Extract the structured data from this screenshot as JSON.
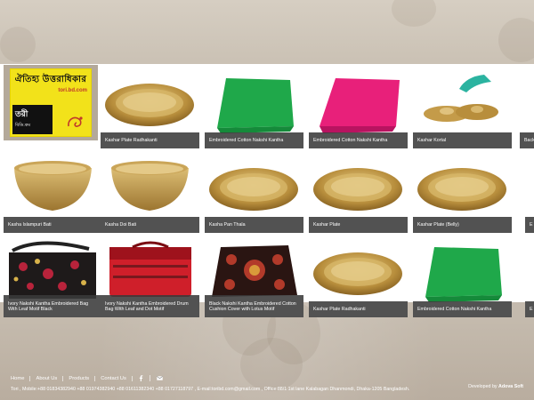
{
  "logo": {
    "title": "ঐতিহ্য উত্তরাধিকার",
    "site": "tori.bd.com",
    "brand": "তরী",
    "sub": "বিডি.কম"
  },
  "products": [
    {
      "name": "Kashar Plate Radhakanti",
      "art": "plate"
    },
    {
      "name": "Embroidered Cotton Nakshi Kantha",
      "art": "green"
    },
    {
      "name": "Embroidered Cotton Nakshi Kantha",
      "art": "pink"
    },
    {
      "name": "Kashar Kortal",
      "art": "cymbal"
    },
    {
      "name": "Back",
      "art": "blank"
    },
    {
      "name": "Kasha Islampuri Bati",
      "art": "bowl"
    },
    {
      "name": "Kasha Doi Bati",
      "art": "bowl"
    },
    {
      "name": "Kasha Pan Thala",
      "art": "plate"
    },
    {
      "name": "Kashar Plate",
      "art": "plate"
    },
    {
      "name": "Kashar Plate (Belly)",
      "art": "plate"
    },
    {
      "name": "E",
      "art": "blank"
    },
    {
      "name": "Ivory Nakshi Kantha Embroidered Bag With Leaf Motif Black",
      "art": "bag"
    },
    {
      "name": "Ivory Nakshi Kantha Embroidered Drum Bag With Leaf and Dot Motif",
      "art": "drumbag"
    },
    {
      "name": "Black Nakshi Kantha Embroidered Cotton Cushion Cover with Lotus Motif",
      "art": "cushion"
    },
    {
      "name": "Kashar Plate Radhakanti",
      "art": "plate"
    },
    {
      "name": "Embroidered Cotton Nakshi Kantha",
      "art": "green"
    },
    {
      "name": "E",
      "art": "blank"
    }
  ],
  "footer": {
    "nav": [
      "Home",
      "About Us",
      "Products",
      "Contact Us"
    ],
    "icons": [
      "facebook-icon",
      "email-icon"
    ],
    "info": "Tori , Mobile:+88 01834382940 +88 01974382940 +88 01611382340 +88 01727118797 , E-mail:toribd.com@gmail.com , Office:88/1 1st lane Kalabagan Dhanmondi, Dhaka-1205 Bangladesh.",
    "developer_prefix": "Developed by",
    "developer": "Adova Soft"
  },
  "colors": {
    "caption_bg": "#3a3a3a",
    "brass": "#c8a24a",
    "kantha_green": "#1fa84a",
    "kantha_pink": "#e8207a"
  }
}
